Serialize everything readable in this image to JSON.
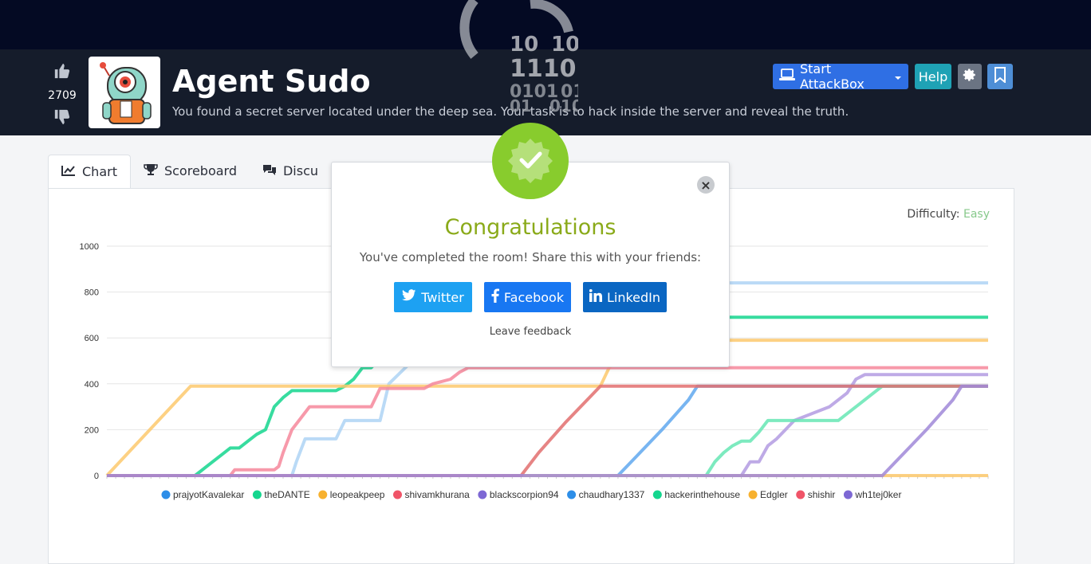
{
  "room": {
    "title": "Agent Sudo",
    "description": "You found a secret server located under the deep sea. Your task is to hack inside the server and reveal the truth.",
    "votes": "2709"
  },
  "header": {
    "attackbox_label": "Start AttackBox",
    "help_label": "Help"
  },
  "tabs": [
    {
      "label": "Chart",
      "icon": "chart-line-icon"
    },
    {
      "label": "Scoreboard",
      "icon": "trophy-icon"
    },
    {
      "label": "Discu",
      "icon": "comments-icon"
    }
  ],
  "difficulty": {
    "label": "Difficulty:",
    "value": "Easy"
  },
  "overlay_text": {
    "row1a": "10",
    "row1b": "10",
    "row2": "1110",
    "row3a": "0101",
    "row3b": "01",
    "row4a": "01",
    "row4b": "010"
  },
  "modal": {
    "title": "Congratulations",
    "subtitle": "You've completed the room! Share this with your friends:",
    "twitter": "Twitter",
    "facebook": "Facebook",
    "linkedin": "LinkedIn",
    "feedback": "Leave feedback",
    "close": "×"
  },
  "chart_data": {
    "type": "line",
    "ylim": [
      0,
      1000
    ],
    "yticks": [
      0,
      200,
      400,
      600,
      800,
      1000
    ],
    "x": [
      0,
      100
    ],
    "series": [
      {
        "name": "prajyotKavalekar",
        "color": "#aed4f5",
        "points": [
          [
            0,
            0
          ],
          [
            21,
            0
          ],
          [
            21.5,
            60
          ],
          [
            22.5,
            160
          ],
          [
            26,
            160
          ],
          [
            27,
            240
          ],
          [
            31,
            240
          ],
          [
            32,
            400
          ],
          [
            36,
            550
          ],
          [
            40,
            840
          ],
          [
            100,
            840
          ]
        ]
      },
      {
        "name": "theDANTE",
        "color": "#14d68e",
        "points": [
          [
            0,
            0
          ],
          [
            10,
            0
          ],
          [
            12,
            60
          ],
          [
            13,
            90
          ],
          [
            14,
            120
          ],
          [
            15,
            120
          ],
          [
            16,
            150
          ],
          [
            17,
            180
          ],
          [
            18,
            200
          ],
          [
            19,
            300
          ],
          [
            20,
            340
          ],
          [
            21,
            370
          ],
          [
            25,
            370
          ],
          [
            26,
            370
          ],
          [
            27,
            390
          ],
          [
            28,
            420
          ],
          [
            29,
            470
          ],
          [
            30,
            470
          ],
          [
            33,
            600
          ],
          [
            36,
            690
          ],
          [
            100,
            690
          ]
        ]
      },
      {
        "name": "leopeakpeep",
        "color": "#fdc96d",
        "points": [
          [
            0,
            0
          ],
          [
            9.5,
            390
          ],
          [
            55,
            390
          ],
          [
            56,
            390
          ],
          [
            57,
            470
          ],
          [
            59,
            540
          ],
          [
            62,
            590
          ],
          [
            100,
            590
          ]
        ]
      },
      {
        "name": "shivamkhurana",
        "color": "#f6879b",
        "points": [
          [
            0,
            0
          ],
          [
            14,
            0
          ],
          [
            14.5,
            25
          ],
          [
            19,
            25
          ],
          [
            19.5,
            40
          ],
          [
            20,
            100
          ],
          [
            21,
            200
          ],
          [
            22,
            250
          ],
          [
            23,
            300
          ],
          [
            30,
            300
          ],
          [
            31,
            380
          ],
          [
            36,
            380
          ],
          [
            37,
            400
          ],
          [
            39,
            420
          ],
          [
            40,
            450
          ],
          [
            41,
            470
          ],
          [
            100,
            470
          ]
        ]
      },
      {
        "name": "blackscorpion94",
        "color": "#b39be2",
        "points": [
          [
            0,
            0
          ],
          [
            72,
            0
          ],
          [
            72,
            0
          ],
          [
            73,
            60
          ],
          [
            74,
            60
          ],
          [
            75,
            130
          ],
          [
            76,
            160
          ],
          [
            77,
            200
          ],
          [
            78,
            240
          ],
          [
            82,
            300
          ],
          [
            84,
            360
          ],
          [
            85,
            420
          ],
          [
            86,
            440
          ],
          [
            100,
            440
          ]
        ]
      },
      {
        "name": "chaudhary1337",
        "color": "#60a8ef",
        "points": [
          [
            0,
            0
          ],
          [
            58,
            0
          ],
          [
            60,
            80
          ],
          [
            63,
            200
          ],
          [
            66,
            330
          ],
          [
            67,
            390
          ],
          [
            100,
            390
          ]
        ]
      },
      {
        "name": "hackerinthehouse",
        "color": "#66e6b4",
        "points": [
          [
            0,
            0
          ],
          [
            68,
            0
          ],
          [
            69,
            60
          ],
          [
            70,
            100
          ],
          [
            71,
            130
          ],
          [
            72,
            150
          ],
          [
            73,
            150
          ],
          [
            74,
            190
          ],
          [
            75,
            240
          ],
          [
            83,
            240
          ],
          [
            85,
            300
          ],
          [
            87,
            360
          ],
          [
            88,
            390
          ],
          [
            100,
            390
          ]
        ]
      },
      {
        "name": "Edgler",
        "color": "#fdc96d",
        "points": [
          [
            0,
            0
          ],
          [
            100,
            0
          ]
        ]
      },
      {
        "name": "shishir",
        "color": "#e26f6f",
        "points": [
          [
            0,
            0
          ],
          [
            47,
            0
          ],
          [
            49,
            100
          ],
          [
            52,
            230
          ],
          [
            55,
            350
          ],
          [
            56,
            390
          ],
          [
            100,
            390
          ]
        ]
      },
      {
        "name": "wh1tej0ker",
        "color": "#a088d8",
        "points": [
          [
            0,
            0
          ],
          [
            88,
            0
          ],
          [
            90,
            80
          ],
          [
            93,
            200
          ],
          [
            96,
            330
          ],
          [
            97,
            390
          ],
          [
            100,
            390
          ]
        ]
      }
    ],
    "legend": [
      {
        "name": "prajyotKavalekar",
        "color": "#2d8ee8"
      },
      {
        "name": "theDANTE",
        "color": "#14d68e"
      },
      {
        "name": "leopeakpeep",
        "color": "#f7b12f"
      },
      {
        "name": "shivamkhurana",
        "color": "#f05468"
      },
      {
        "name": "blackscorpion94",
        "color": "#7d68d4"
      },
      {
        "name": "chaudhary1337",
        "color": "#2d8ee8"
      },
      {
        "name": "hackerinthehouse",
        "color": "#14d68e"
      },
      {
        "name": "Edgler",
        "color": "#f7b12f"
      },
      {
        "name": "shishir",
        "color": "#f05468"
      },
      {
        "name": "wh1tej0ker",
        "color": "#7d68d4"
      }
    ]
  }
}
